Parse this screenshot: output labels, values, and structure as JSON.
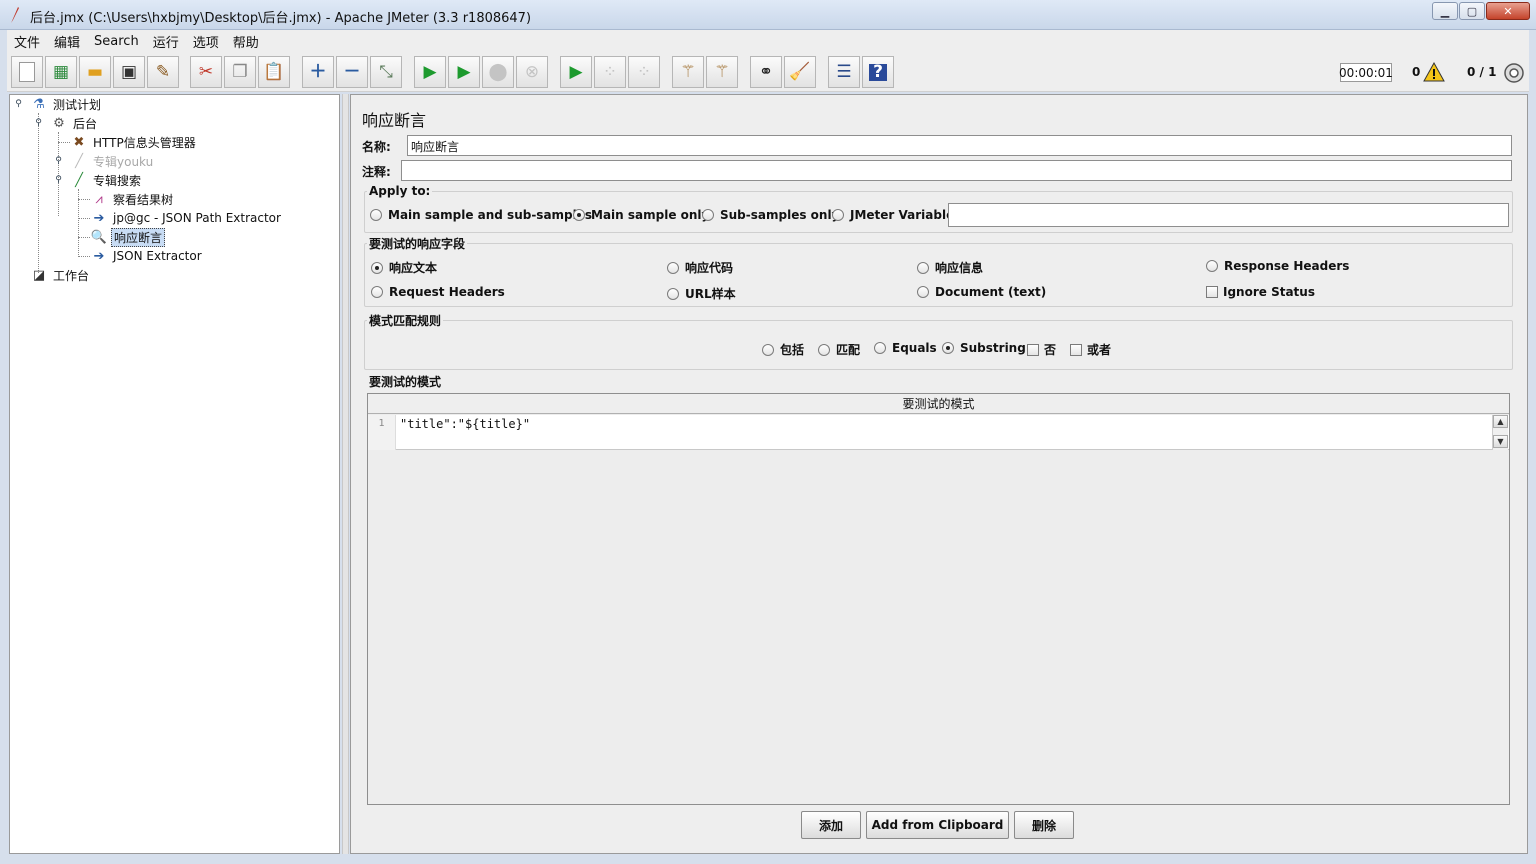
{
  "window": {
    "title": "后台.jmx (C:\\Users\\hxbjmy\\Desktop\\后台.jmx) - Apache JMeter (3.3 r1808647)"
  },
  "menu": [
    "文件",
    "编辑",
    "Search",
    "运行",
    "选项",
    "帮助"
  ],
  "status": {
    "timer": "00:00:01",
    "errors": "0",
    "threads": "0 / 1"
  },
  "tree": {
    "test_plan": "测试计划",
    "thread_group": "后台",
    "http_header_manager": "HTTP信息头管理器",
    "sampler_youku": "专辑youku",
    "sampler_search": "专辑搜索",
    "view_results_tree": "察看结果树",
    "json_path_extractor": "jp@gc - JSON Path Extractor",
    "response_assertion": "响应断言",
    "json_extractor": "JSON Extractor",
    "workbench": "工作台"
  },
  "panel": {
    "title": "响应断言",
    "name_label": "名称:",
    "name_value": "响应断言",
    "comment_label": "注释:",
    "comment_value": "",
    "apply_to": {
      "title": "Apply to:",
      "options": [
        "Main sample and sub-samples",
        "Main sample only",
        "Sub-samples only",
        "JMeter Variable"
      ],
      "selected": "Main sample only",
      "variable_value": ""
    },
    "field_to_test": {
      "title": "要测试的响应字段",
      "opt_text": "响应文本",
      "opt_code": "响应代码",
      "opt_message": "响应信息",
      "opt_response_headers": "Response Headers",
      "opt_request_headers": "Request Headers",
      "opt_url": "URL样本",
      "opt_document": "Document (text)",
      "opt_ignore_status": "Ignore Status",
      "selected": "响应文本"
    },
    "pattern_rules": {
      "title": "模式匹配规则",
      "opt_contains": "包括",
      "opt_matches": "匹配",
      "opt_equals": "Equals",
      "opt_substring": "Substring",
      "opt_not": "否",
      "opt_or": "或者",
      "selected": "Substring"
    },
    "patterns": {
      "title": "要测试的模式",
      "column_header": "要测试的模式",
      "rows": [
        {
          "line": "1",
          "text": "\"title\":\"${title}\""
        }
      ]
    },
    "buttons": {
      "add": "添加",
      "add_clipboard": "Add from Clipboard",
      "delete": "删除"
    }
  }
}
